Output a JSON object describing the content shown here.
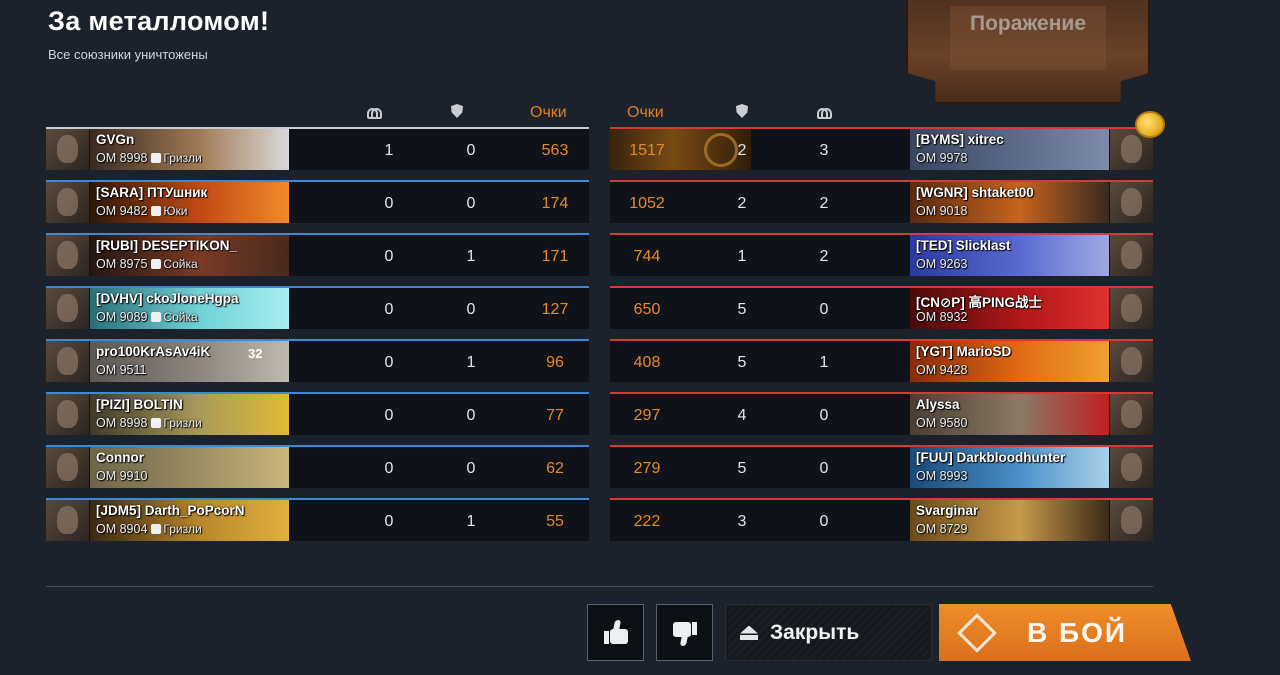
{
  "header": {
    "title": "За металломом!",
    "subtitle": "Все союзники уничтожены",
    "result": "Поражение"
  },
  "columns": {
    "left_score": "Очки",
    "right_score": "Очки"
  },
  "allies": [
    {
      "name": "GVGn",
      "rating": "ОМ 8998",
      "clan": "Гризли",
      "kills": "1",
      "assists": "0",
      "score": "563",
      "colors": [
        "#3a2a20",
        "#a07a55",
        "#d9d9d9"
      ],
      "me": true
    },
    {
      "name": "[SARA] ПТУшник",
      "rating": "ОМ 9482",
      "clan": "Юки",
      "kills": "0",
      "assists": "0",
      "score": "174",
      "colors": [
        "#2a1808",
        "#c24a12",
        "#f08a2a"
      ]
    },
    {
      "name": "[RUBI] DESEPTIKON_",
      "rating": "ОМ 8975",
      "clan": "Сойка",
      "kills": "0",
      "assists": "1",
      "score": "171",
      "colors": [
        "#241614",
        "#7a3a24",
        "#4a2a20"
      ]
    },
    {
      "name": "[DVHV] ckoJloneHgpa",
      "rating": "ОМ 9089",
      "clan": "Сойка",
      "kills": "0",
      "assists": "0",
      "score": "127",
      "colors": [
        "#2a6f77",
        "#6fd2d6",
        "#a7ecee"
      ]
    },
    {
      "name": "pro100KrAsAv4iK",
      "rating": "ОМ 9511",
      "badge": "32",
      "kills": "0",
      "assists": "1",
      "score": "96",
      "colors": [
        "#5d5753",
        "#8e867e",
        "#bfb8ae"
      ]
    },
    {
      "name": "[PIZI] BOLTIN",
      "rating": "ОМ 8998",
      "clan": "Гризли",
      "kills": "0",
      "assists": "0",
      "score": "77",
      "colors": [
        "#3f3a2a",
        "#a89a5a",
        "#e1b934"
      ]
    },
    {
      "name": "Connor",
      "rating": "ОМ 9910",
      "kills": "0",
      "assists": "0",
      "score": "62",
      "colors": [
        "#6f6548",
        "#9b8e62",
        "#c9b67a"
      ]
    },
    {
      "name": "[JDM5] Darth_PoPcorN",
      "rating": "ОМ 8904",
      "clan": "Гризли",
      "kills": "0",
      "assists": "1",
      "score": "55",
      "colors": [
        "#3a2812",
        "#b8862a",
        "#e0b040"
      ]
    }
  ],
  "enemies": [
    {
      "name": "[BYMS] xitrec",
      "rating": "ОМ 9978",
      "score": "1517",
      "assists": "2",
      "kills": "3",
      "colors": [
        "#3a4560",
        "#5d6c8a",
        "#7d8aa8"
      ],
      "top": true
    },
    {
      "name": "[WGNR] shtaket00",
      "rating": "ОМ 9018",
      "score": "1052",
      "assists": "2",
      "kills": "2",
      "colors": [
        "#5a2a10",
        "#c8641c",
        "#3a2a20"
      ]
    },
    {
      "name": "[TED] Slicklast",
      "rating": "ОМ 9263",
      "score": "744",
      "assists": "1",
      "kills": "2",
      "colors": [
        "#2a3aa0",
        "#5a6ad0",
        "#a0a8e0"
      ]
    },
    {
      "name": "[CN⊘P] 高PING战士",
      "rating": "ОМ 8932",
      "score": "650",
      "assists": "5",
      "kills": "0",
      "colors": [
        "#4a0a0a",
        "#b01818",
        "#e03030"
      ]
    },
    {
      "name": "[YGT] MarioSD",
      "rating": "ОМ 9428",
      "score": "408",
      "assists": "5",
      "kills": "1",
      "colors": [
        "#8a2a0a",
        "#e06a14",
        "#f0a030"
      ]
    },
    {
      "name": "Alyssa",
      "rating": "ОМ 9580",
      "score": "297",
      "assists": "4",
      "kills": "0",
      "colors": [
        "#4a3e34",
        "#8a7a66",
        "#c02020"
      ]
    },
    {
      "name": "[FUU] Darkbloodhunter",
      "rating": "ОМ 8993",
      "score": "279",
      "assists": "5",
      "kills": "0",
      "colors": [
        "#1a4a7a",
        "#4a90c8",
        "#a8d0e8"
      ]
    },
    {
      "name": "Svarginar",
      "rating": "ОМ 8729",
      "score": "222",
      "assists": "3",
      "kills": "0",
      "colors": [
        "#6a4a1a",
        "#c89a4a",
        "#3a2a18"
      ]
    }
  ],
  "footer": {
    "close_label": "Закрыть",
    "battle_label": "В БОЙ"
  },
  "icons": {
    "kills": "kills-icon",
    "assists": "shield-icon",
    "like": "thumbs-up-icon",
    "dislike": "thumbs-down-icon",
    "close": "garage-icon",
    "battle": "battle-icon",
    "coin": "coin-icon"
  },
  "colors": {
    "background": "#1c222b",
    "ally_line": "#3b89d9",
    "enemy_line": "#d63a34",
    "score": "#e8892a",
    "battle_button": "#f08d2a"
  }
}
